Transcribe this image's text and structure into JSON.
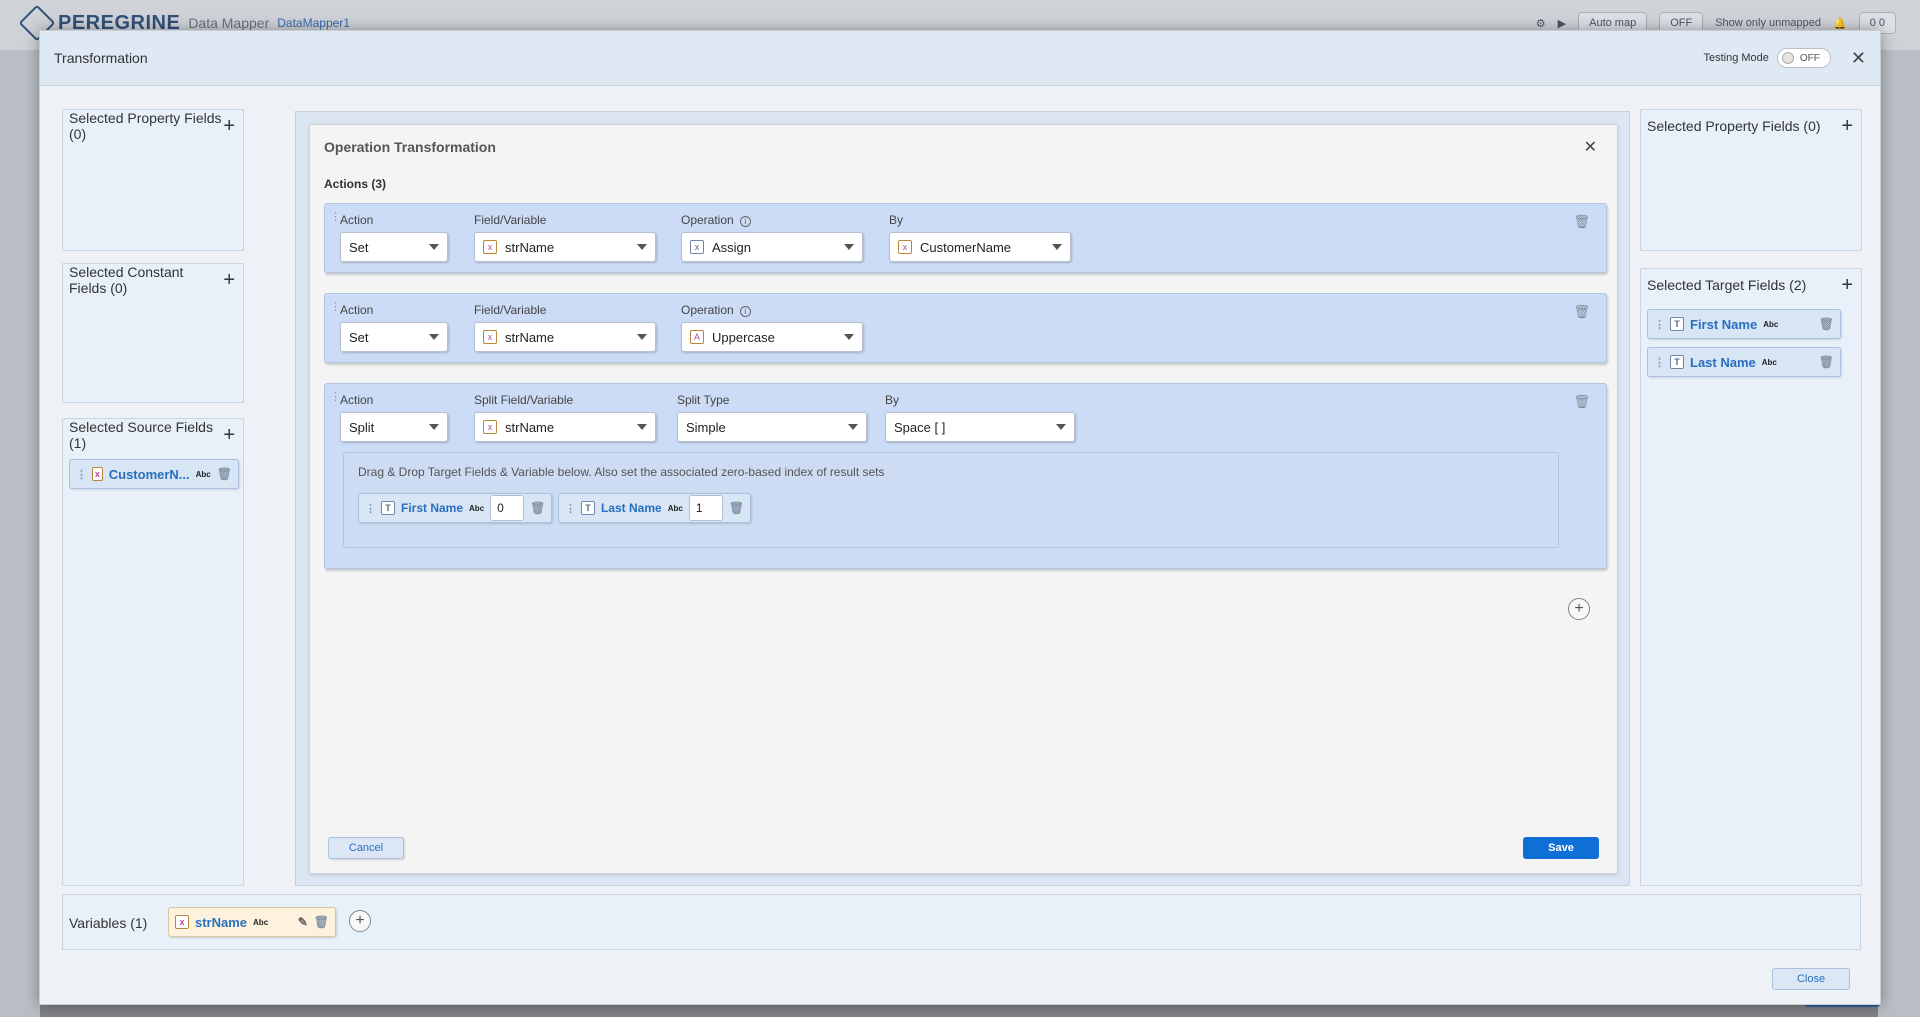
{
  "background": {
    "brand": "PEREGRINE",
    "product": "Data Mapper",
    "file": "DataMapper1",
    "auto_map": "Auto map",
    "off": "OFF",
    "show_unmapped": "Show only unmapped",
    "counts": "0   0"
  },
  "modal": {
    "title": "Transformation",
    "testing_mode_label": "Testing Mode",
    "testing_mode_value": "OFF",
    "close_label": "Close"
  },
  "left": {
    "property_fields": "Selected Property Fields (0)",
    "constant_fields": "Selected Constant Fields (0)",
    "source_fields": "Selected Source Fields (1)",
    "source_items": [
      {
        "label": "CustomerN...",
        "type": "Abc"
      }
    ]
  },
  "right": {
    "property_fields": "Selected Property Fields (0)",
    "target_fields": "Selected Target Fields (2)",
    "target_items": [
      {
        "label": "First Name",
        "type": "Abc"
      },
      {
        "label": "Last Name",
        "type": "Abc"
      }
    ]
  },
  "operation": {
    "title": "Operation Transformation",
    "actions_label": "Actions (3)",
    "actions": [
      {
        "action_label": "Action",
        "action_value": "Set",
        "field_label": "Field/Variable",
        "field_value": "strName",
        "op_label": "Operation",
        "op_value": "Assign",
        "by_label": "By",
        "by_value": "CustomerName"
      },
      {
        "action_label": "Action",
        "action_value": "Set",
        "field_label": "Field/Variable",
        "field_value": "strName",
        "op_label": "Operation",
        "op_value": "Uppercase"
      },
      {
        "action_label": "Action",
        "action_value": "Split",
        "field_label": "Split Field/Variable",
        "field_value": "strName",
        "op_label": "Split Type",
        "op_value": "Simple",
        "by_label": "By",
        "by_value": "Space [ ]",
        "dropzone_text": "Drag & Drop Target Fields & Variable below. Also set the associated zero-based index of result sets",
        "targets": [
          {
            "label": "First Name",
            "type": "Abc",
            "index": "0"
          },
          {
            "label": "Last Name",
            "type": "Abc",
            "index": "1"
          }
        ]
      }
    ],
    "cancel_label": "Cancel",
    "save_label": "Save"
  },
  "variables": {
    "label": "Variables (1)",
    "items": [
      {
        "label": "strName",
        "type": "Abc"
      }
    ]
  },
  "colors": {
    "accent": "#0f6fd6",
    "chip_text": "#2a6fbf",
    "action_bg": "#ccdcf6"
  }
}
